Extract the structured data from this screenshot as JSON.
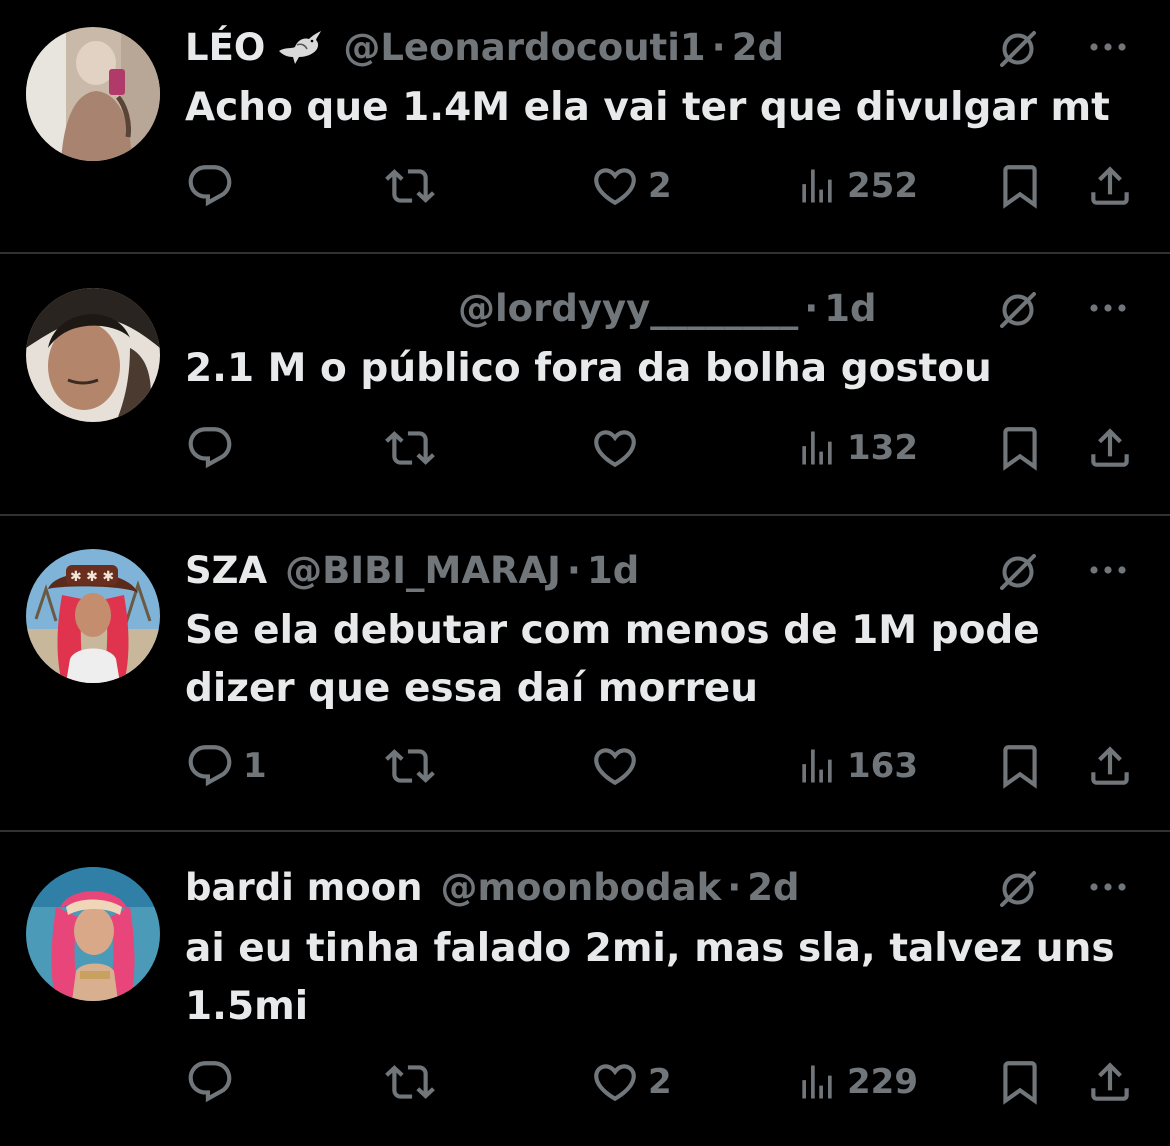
{
  "tweets": [
    {
      "name": "LÉO",
      "handle": "@Leonardocouti1",
      "sep": "·",
      "time": "2d",
      "text": "Acho que 1.4M ela vai ter que divulgar mt",
      "replies": "",
      "likes": "2",
      "views": "252"
    },
    {
      "name": "",
      "handle": "@lordyyy________",
      "sep": "·",
      "time": "1d",
      "text": "2.1 M o público fora da bolha gostou",
      "replies": "",
      "likes": "",
      "views": "132"
    },
    {
      "name": "SZA",
      "handle": "@BIBI_MARAJ",
      "sep": "·",
      "time": "1d",
      "text": "Se ela debutar com menos de 1M pode dizer que essa daí morreu",
      "replies": "1",
      "likes": "",
      "views": "163"
    },
    {
      "name": "bardi moon",
      "handle": "@moonbodak",
      "sep": "·",
      "time": "2d",
      "text": "ai eu tinha falado 2mi, mas sla, talvez uns 1.5mi",
      "replies": "",
      "likes": "2",
      "views": "229"
    }
  ],
  "icons": {
    "reply": "reply-icon",
    "retweet": "retweet-icon",
    "like": "heart-icon",
    "views": "views-icon",
    "bookmark": "bookmark-icon",
    "share": "share-icon",
    "mute": "mute-icon",
    "more": "more-icon",
    "badge": "bird-icon"
  },
  "colors": {
    "background": "#000000",
    "primary_text": "#e7e9ea",
    "secondary_text": "#71767b",
    "divider": "#2f3336"
  }
}
